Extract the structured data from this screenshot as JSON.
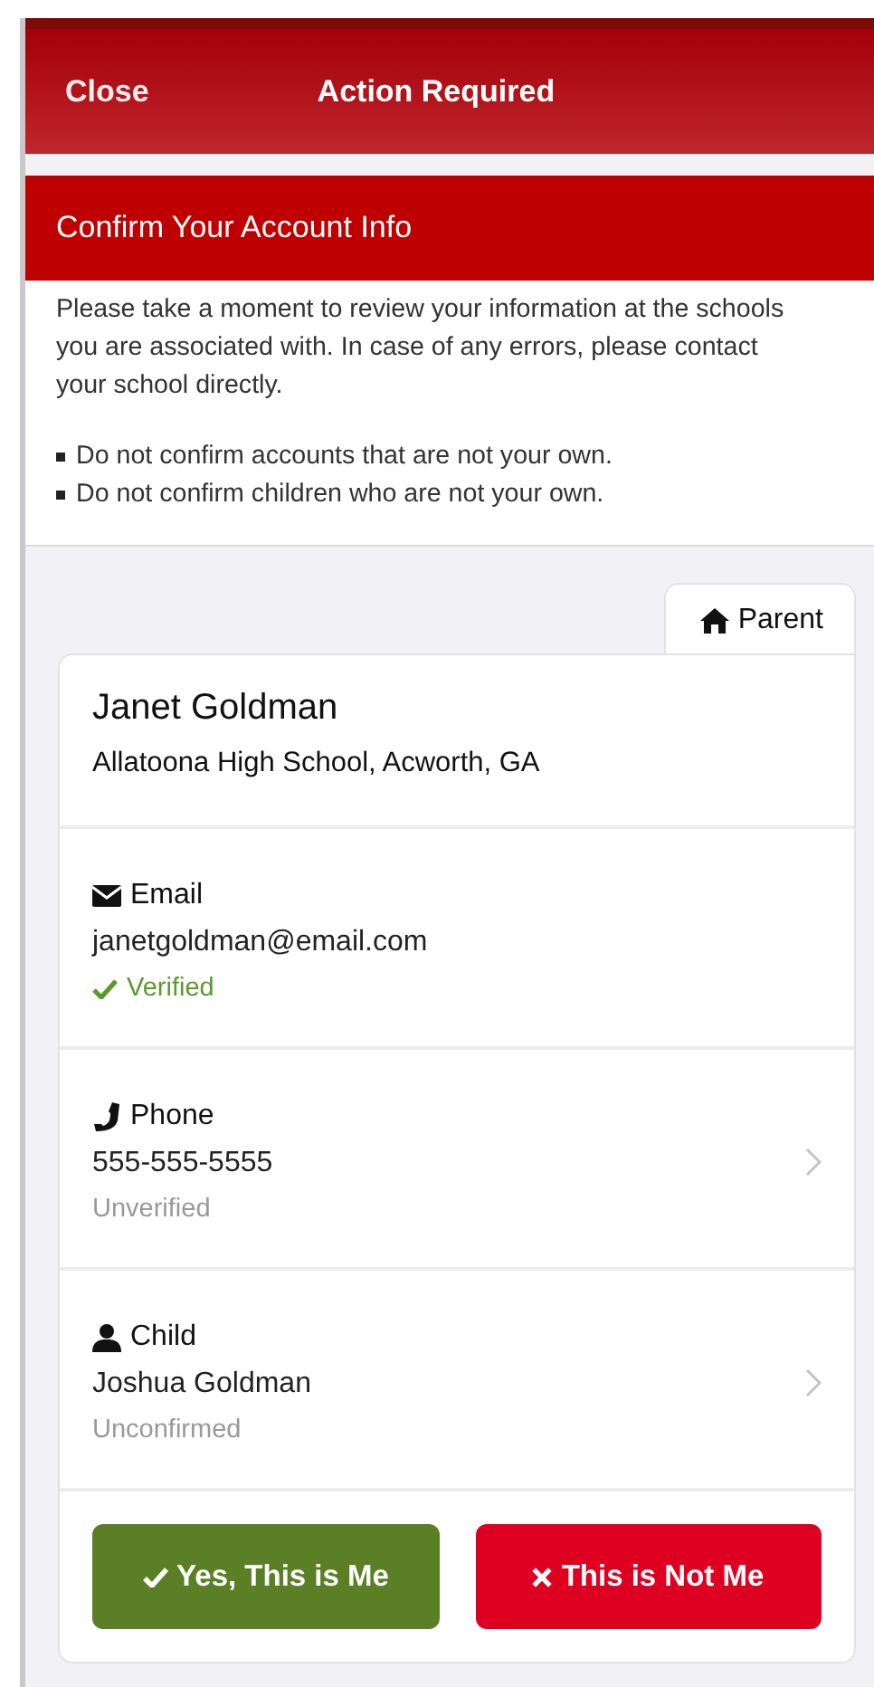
{
  "header": {
    "close": "Close",
    "title": "Action Required"
  },
  "section": {
    "title": "Confirm Your Account Info",
    "intro": "Please take a moment to review your information at the schools you are associated with. In case of any errors, please contact your school directly.",
    "bullets": [
      "Do not confirm accounts that are not your own.",
      "Do not confirm children who are not your own."
    ]
  },
  "tabs": [
    {
      "label": "Parent",
      "selected": true
    }
  ],
  "card": {
    "name": "Janet Goldman",
    "school": "Allatoona High School, Acworth, GA",
    "rows": [
      {
        "kind": "email",
        "label": "Email",
        "value": "janetgoldman@email.com",
        "status": "Verified",
        "verified": true,
        "expandable": false
      },
      {
        "kind": "phone",
        "label": "Phone",
        "value": "555-555-5555",
        "status": "Unverified",
        "verified": false,
        "expandable": true
      },
      {
        "kind": "child",
        "label": "Child",
        "value": "Joshua Goldman",
        "status": "Unconfirmed",
        "verified": false,
        "expandable": true
      }
    ],
    "buttons": [
      {
        "kind": "confirm",
        "label": "Yes, This is Me"
      },
      {
        "kind": "reject",
        "label": "This is Not Me"
      }
    ]
  }
}
